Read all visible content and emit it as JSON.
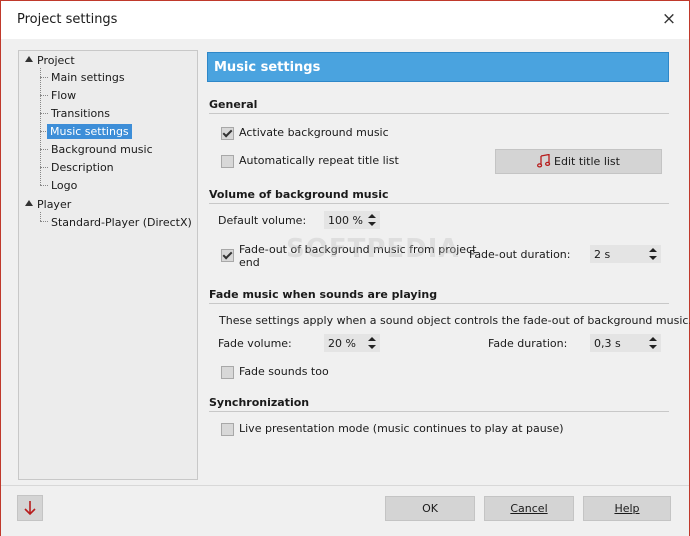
{
  "window": {
    "title": "Project settings",
    "close_glyph": "×"
  },
  "tree": {
    "project_label": "Project",
    "project_children": [
      "Main settings",
      "Flow",
      "Transitions",
      "Music settings",
      "Background music",
      "Description",
      "Logo"
    ],
    "selected": "Music settings",
    "player_label": "Player",
    "player_children": [
      "Standard-Player (DirectX)"
    ]
  },
  "content": {
    "header": "Music settings",
    "general": {
      "title": "General",
      "activate_label": "Activate background music",
      "activate_checked": true,
      "repeat_label": "Automatically repeat title list",
      "repeat_checked": false,
      "edit_button_label": "Edit title list",
      "edit_button_icon": "music-note-icon",
      "accent": "#b71c1c"
    },
    "volume": {
      "title": "Volume of background music",
      "default_volume_label": "Default volume:",
      "default_volume_value": "100 %",
      "fadeout_label_line1": "Fade-out of background music from project",
      "fadeout_label_line2": "end",
      "fadeout_checked": true,
      "fadeout_duration_label": "Fade-out duration:",
      "fadeout_duration_value": "2 s"
    },
    "fade_sounds": {
      "title": "Fade music when sounds are playing",
      "description": "These settings apply when a sound object controls the fade-out of background music.",
      "fade_volume_label": "Fade volume:",
      "fade_volume_value": "20 %",
      "fade_duration_label": "Fade duration:",
      "fade_duration_value": "0,3 s",
      "fade_sounds_too_label": "Fade sounds too",
      "fade_sounds_too_checked": false
    },
    "sync": {
      "title": "Synchronization",
      "live_label": "Live presentation mode (music continues to play at pause)",
      "live_checked": false
    }
  },
  "watermark": "SOFTPEDIA",
  "buttons": {
    "ok": "OK",
    "cancel": "Cancel",
    "help": "Help",
    "down_icon": "down-arrow-icon"
  },
  "colors": {
    "header_bg": "#4aa3df",
    "selection": "#3d8ed8",
    "window_border": "#c0392b",
    "arrow_red": "#b71c1c"
  }
}
